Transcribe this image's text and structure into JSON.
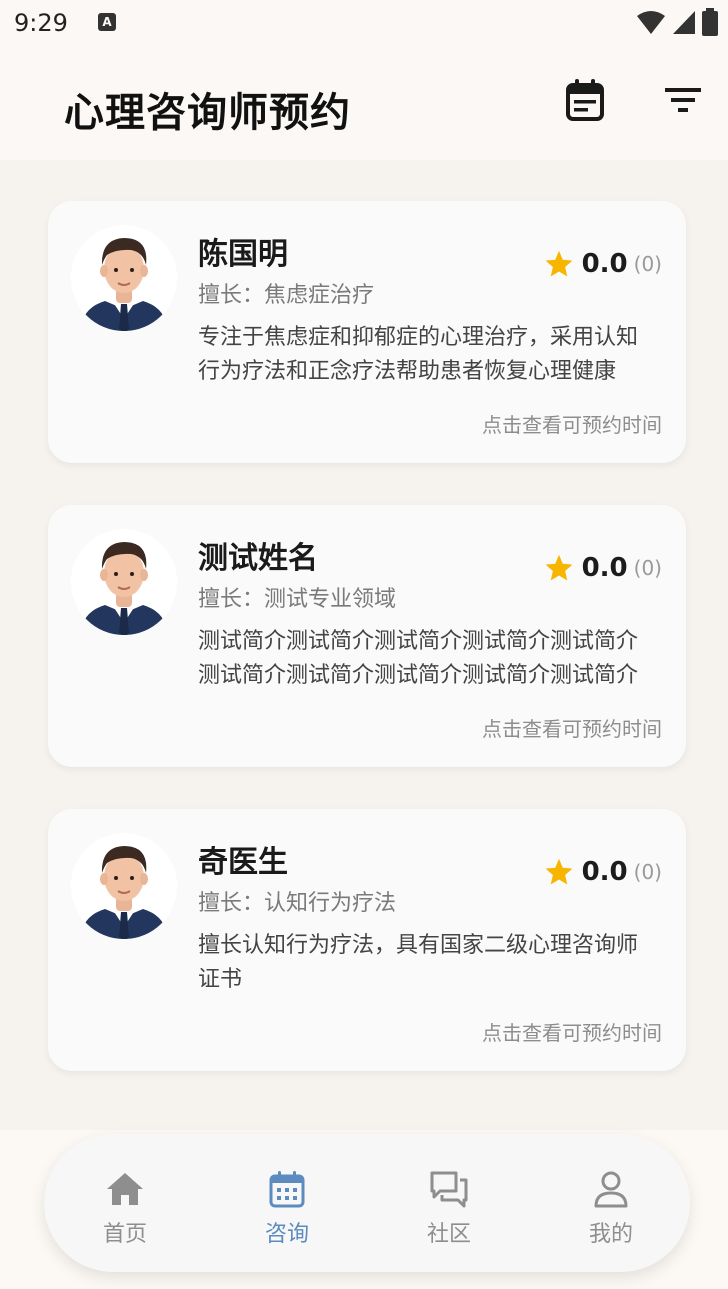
{
  "status_bar": {
    "time": "9:29",
    "indicator": "A"
  },
  "header": {
    "title": "心理咨询师预约",
    "calendar_icon": "calendar-icon",
    "filter_icon": "filter-icon"
  },
  "counselors": [
    {
      "name": "陈国明",
      "specialty": "擅长：焦虑症治疗",
      "rating": "0.0",
      "rating_count": "(0)",
      "bio": "专注于焦虑症和抑郁症的心理治疗，采用认知行为疗法和正念疗法帮助患者恢复心理健康",
      "hint": "点击查看可预约时间"
    },
    {
      "name": "测试姓名",
      "specialty": "擅长：测试专业领域",
      "rating": "0.0",
      "rating_count": "(0)",
      "bio": "测试简介测试简介测试简介测试简介测试简介测试简介测试简介测试简介测试简介测试简介",
      "hint": "点击查看可预约时间"
    },
    {
      "name": "奇医生",
      "specialty": "擅长：认知行为疗法",
      "rating": "0.0",
      "rating_count": "(0)",
      "bio": "擅长认知行为疗法，具有国家二级心理咨询师证书",
      "hint": "点击查看可预约时间"
    }
  ],
  "bottom_nav": [
    {
      "label": "首页",
      "icon": "home-icon",
      "active": false
    },
    {
      "label": "咨询",
      "icon": "calendar-icon",
      "active": true
    },
    {
      "label": "社区",
      "icon": "chat-icon",
      "active": false
    },
    {
      "label": "我的",
      "icon": "person-icon",
      "active": false
    }
  ],
  "colors": {
    "accent": "#5b8bbf",
    "star": "#f7b500",
    "background": "#f6f3ef",
    "card": "#fafafa",
    "nav_inactive": "#8e8e8e"
  }
}
